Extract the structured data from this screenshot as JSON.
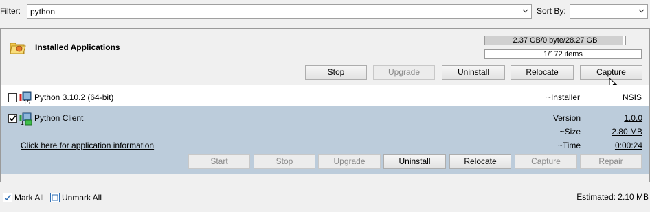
{
  "toolbar": {
    "filter_label": "Filter:",
    "filter_value": "python",
    "sortby_label": "Sort By:",
    "sortby_value": ""
  },
  "panel": {
    "title": "Installed Applications",
    "storage_text": "2.37 GB/0 byte/28.27 GB",
    "storage_fill": 0.98,
    "items_text": "1/172 items",
    "buttons": {
      "stop": "Stop",
      "upgrade": "Upgrade",
      "uninstall": "Uninstall",
      "relocate": "Relocate",
      "capture": "Capture"
    }
  },
  "apps": [
    {
      "name": "Python 3.10.2 (64-bit)",
      "checked": false,
      "installer_label": "~Installer",
      "installer_value": "NSIS"
    },
    {
      "name": "Python Client",
      "checked": true,
      "info_link": "Click here for application information",
      "version_label": "Version",
      "version_value": "1.0.0",
      "size_label": "~Size",
      "size_value": "2.80 MB",
      "time_label": "~Time",
      "time_value": "0:00:24",
      "buttons": {
        "start": "Start",
        "stop": "Stop",
        "upgrade": "Upgrade",
        "uninstall": "Uninstall",
        "relocate": "Relocate",
        "capture": "Capture",
        "repair": "Repair"
      }
    }
  ],
  "footer": {
    "mark_all": "Mark All",
    "unmark_all": "Unmark All",
    "estimated": "Estimated: 2.10 MB"
  },
  "colors": {
    "selected_row": "#bcccdb",
    "background": "#f0f0f0"
  }
}
